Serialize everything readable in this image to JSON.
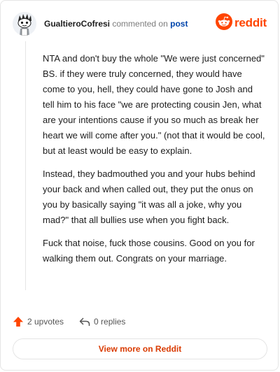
{
  "header": {
    "username": "GualtieroCofresi",
    "action": "commented on",
    "link": "post",
    "brand": "reddit",
    "avatar_icon": "snoo-avatar-icon",
    "brand_icon": "reddit-logo-icon",
    "brand_color": "#ff4500"
  },
  "comment": {
    "paragraphs": [
      "NTA and don't buy the whole \"We were just concerned\" BS. if they were truly concerned, they would have come to you, hell, they could have gone to Josh and tell him to his face \"we are protecting cousin Jen, what are your intentions cause if you so much as break her heart we will come after you.\" (not that it would be cool, but at least would be easy to explain.",
      "Instead, they badmouthed you and your hubs behind your back and when called out, they put the onus on you by basically saying \"it was all a joke, why you mad?\" that all bullies use when you fight back.",
      "Fuck that noise, fuck those cousins. Good on you for walking them out. Congrats on your marriage."
    ]
  },
  "footer": {
    "upvotes": "2 upvotes",
    "replies": "0 replies",
    "upvote_icon": "upvote-arrow-icon",
    "reply_icon": "reply-arrow-icon",
    "upvote_color": "#ff4500"
  },
  "cta": {
    "label": "View more on Reddit"
  }
}
